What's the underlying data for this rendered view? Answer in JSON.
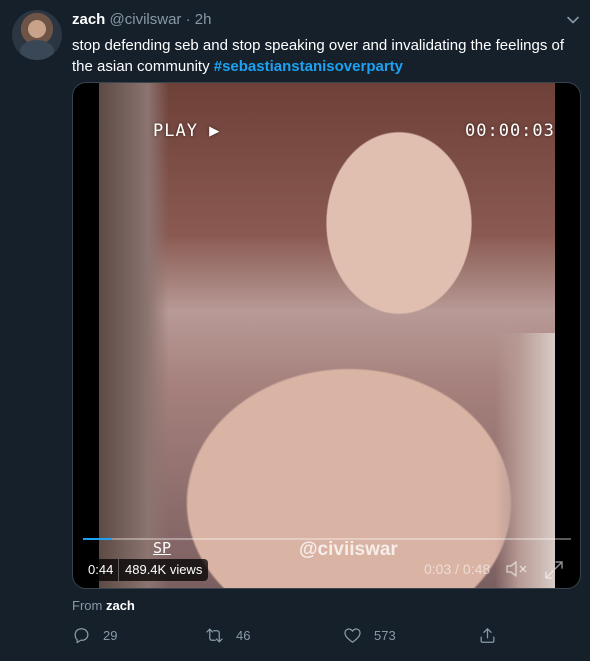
{
  "tweet": {
    "author_name": "zach",
    "author_handle": "@civilswar",
    "separator": "·",
    "time_ago": "2h",
    "text": "stop defending seb and stop speaking over and invalidating the feelings of the asian community ",
    "hashtag": "#sebastianstanisoverparty"
  },
  "media": {
    "vhs_play": "PLAY ▶",
    "vhs_timecode": "00:00:03",
    "vhs_sp": "SP",
    "watermark": "@civiiswar",
    "progress": 0.06,
    "badge_time": "0:44",
    "badge_views": "489.4K views",
    "player_time": "0:03 / 0:48",
    "icons": [
      "tape-icon",
      "mute-icon",
      "expand-icon"
    ]
  },
  "source": {
    "prefix": "From",
    "account": "zach"
  },
  "actions": {
    "reply_count": "29",
    "retweet_count": "46",
    "like_count": "573"
  },
  "colors": {
    "background": "#15202b",
    "accent": "#1da1f2",
    "secondary_text": "#8899a6"
  }
}
